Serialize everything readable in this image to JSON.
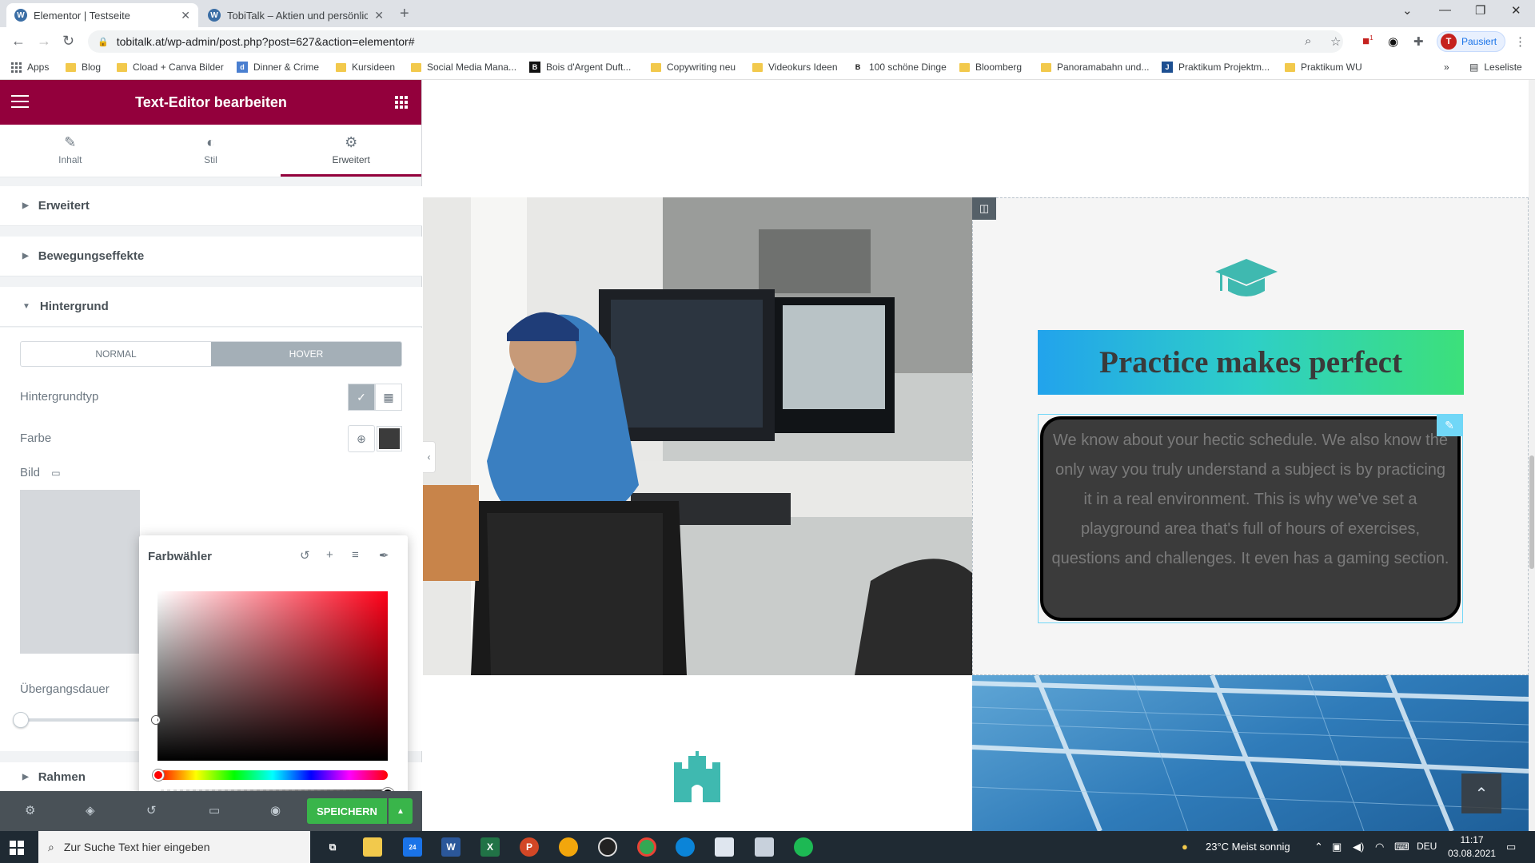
{
  "browser": {
    "tabs": [
      {
        "title": "Elementor | Testseite",
        "active": true
      },
      {
        "title": "TobiTalk – Aktien und persönliche",
        "active": false
      }
    ],
    "url": "tobitalk.at/wp-admin/post.php?post=627&action=elementor#",
    "profile_initial": "T",
    "profile_label": "Pausiert",
    "extension_badge": "1",
    "bookmarks": [
      "Apps",
      "Blog",
      "Cload + Canva Bilder",
      "Dinner & Crime",
      "Kursideen",
      "Social Media Mana...",
      "Bois d'Argent Duft...",
      "Copywriting neu",
      "Videokurs Ideen",
      "100 schöne Dinge",
      "Bloomberg",
      "Panoramabahn und...",
      "Praktikum Projektm...",
      "Praktikum WU"
    ],
    "bookmark_more": "»",
    "reading_list": "Leseliste"
  },
  "panel": {
    "title": "Text-Editor bearbeiten",
    "tabs": [
      {
        "label": "Inhalt",
        "icon": "pencil-icon"
      },
      {
        "label": "Stil",
        "icon": "contrast-icon"
      },
      {
        "label": "Erweitert",
        "icon": "gear-icon"
      }
    ],
    "sections": [
      "Erweitert",
      "Bewegungseffekte",
      "Hintergrund",
      "Rahmen"
    ],
    "state_normal": "NORMAL",
    "state_hover": "HOVER",
    "bg_type_label": "Hintergrundtyp",
    "color_label": "Farbe",
    "image_label": "Bild",
    "transition_label": "Übergangsdauer",
    "swatch_color": "#3B3B3B",
    "save_label": "SPEICHERN"
  },
  "picker": {
    "title": "Farbwähler",
    "hex_value": "#3B3B3B",
    "hue_color": "#ff0018",
    "alpha_level": 1.0
  },
  "preview": {
    "headline": "Practice makes perfect",
    "body": "We know about your hectic schedule. We also know the only way you truly understand a subject is by practicing it in a real environment. This is why we've set a playground area that's full of hours of exercises, questions and challenges. It even has a gaming section.",
    "accent_color": "#3fb9b0",
    "text_bg_color": "#3b3b3b"
  },
  "taskbar": {
    "search_placeholder": "Zur Suche Text hier eingeben",
    "mail_badge": "24",
    "weather": "23°C  Meist sonnig",
    "language": "DEU",
    "time": "11:17",
    "date": "03.08.2021"
  }
}
